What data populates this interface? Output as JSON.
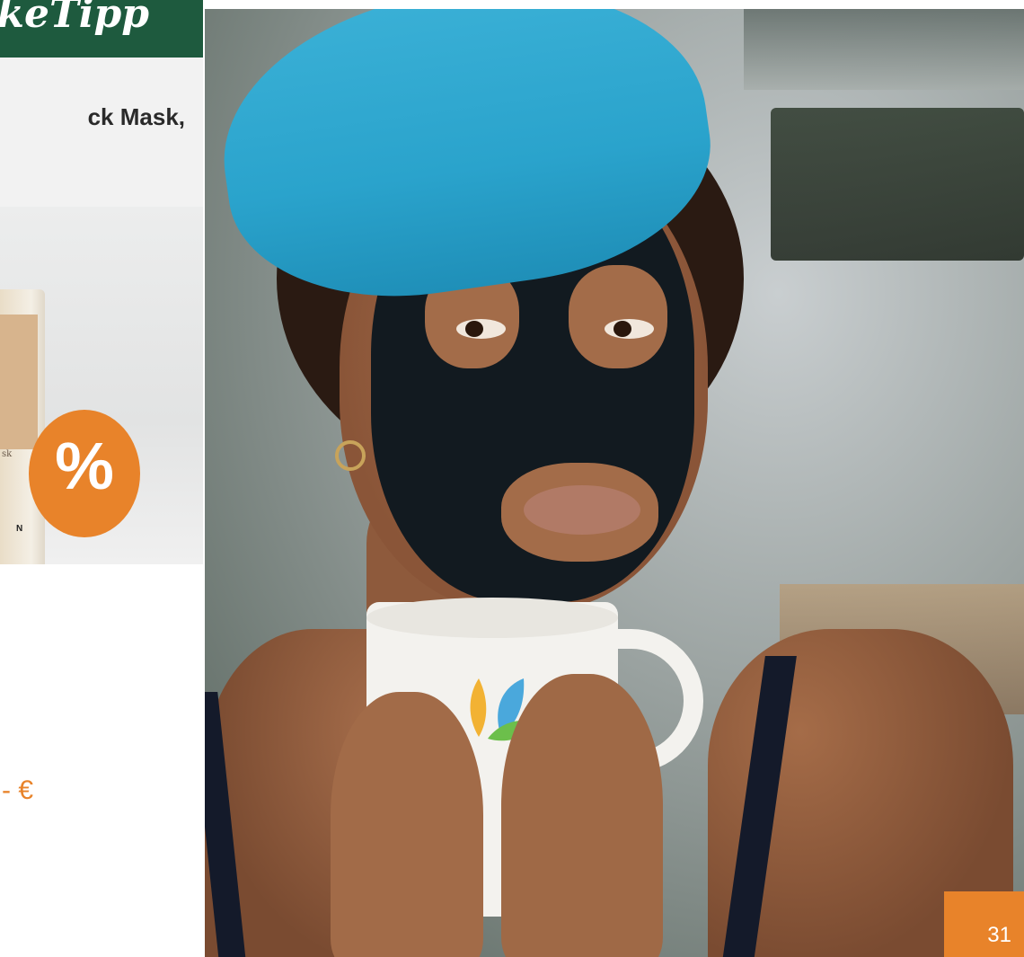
{
  "card": {
    "header_title": "nkeTipp",
    "product_name_line1": "ck Mask,",
    "discount_symbol": "%",
    "price": "- €",
    "tube_label": "sk",
    "tube_logo": "N"
  },
  "page": {
    "number": "31"
  },
  "colors": {
    "header_green": "#1e5a3e",
    "accent_orange": "#e8832a",
    "towel_blue": "#2aa3cc"
  }
}
